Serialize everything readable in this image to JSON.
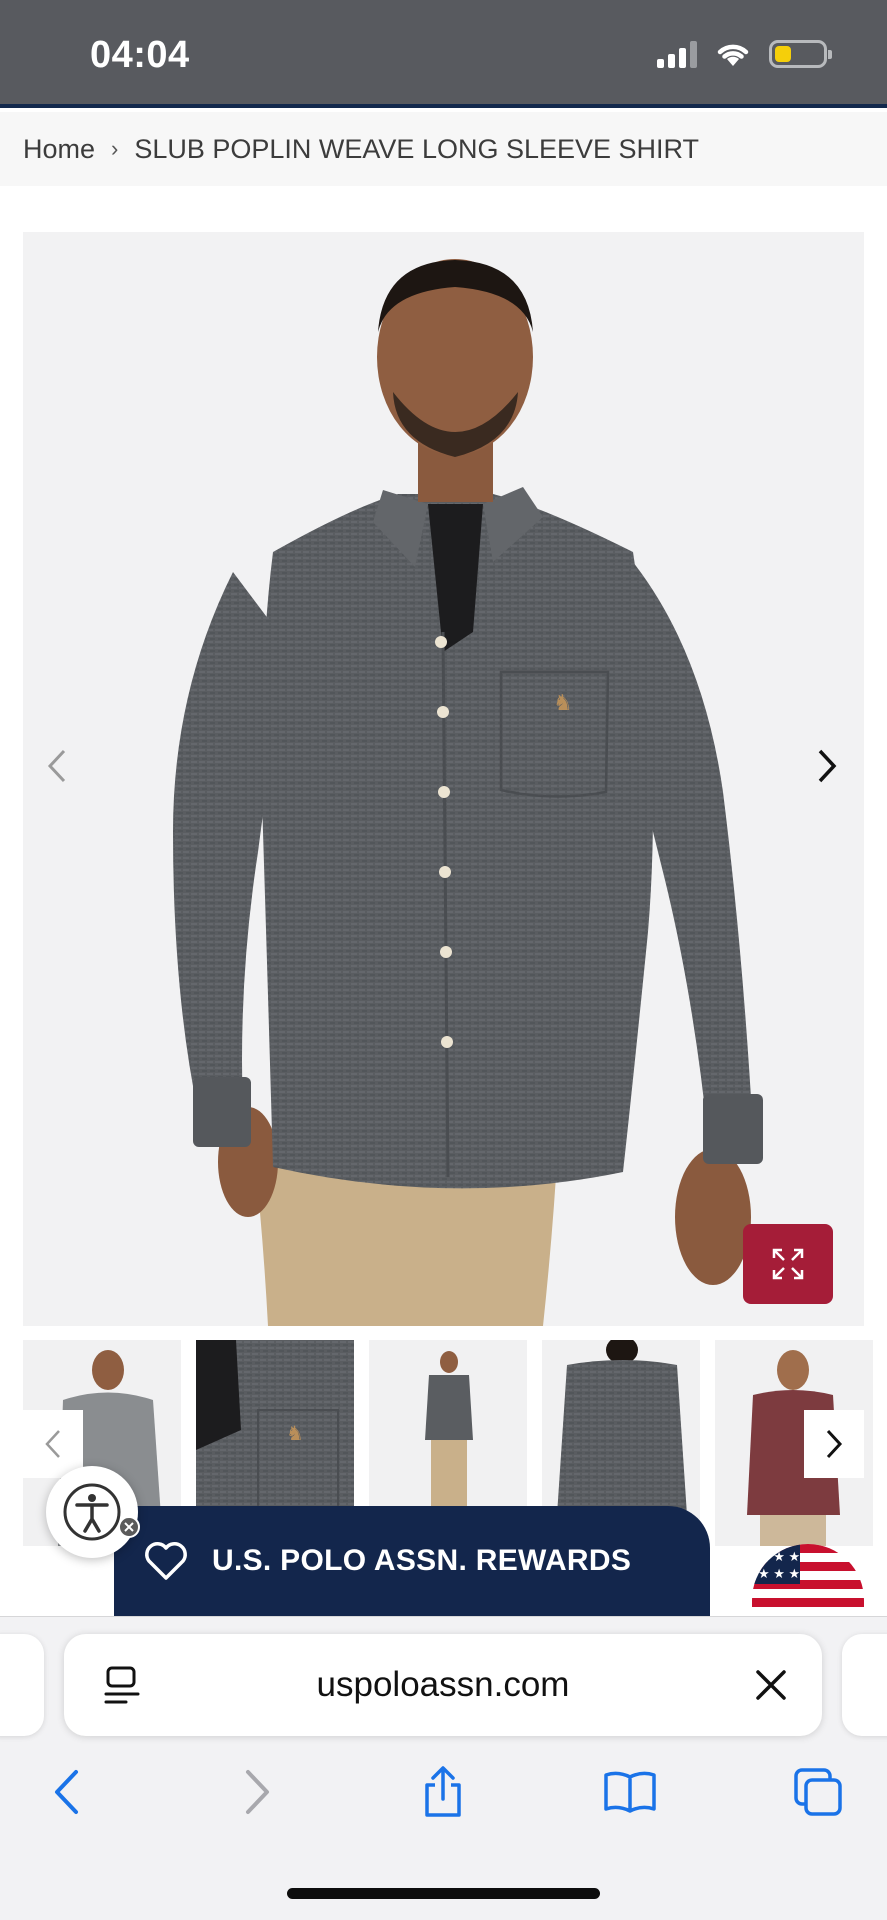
{
  "status_bar": {
    "time": "04:04",
    "icons": [
      "cellular-signal-icon",
      "wifi-icon",
      "battery-low-icon"
    ]
  },
  "breadcrumb": {
    "home": "Home",
    "separator": "›",
    "current": "SLUB POPLIN WEAVE LONG SLEEVE SHIRT"
  },
  "gallery": {
    "main_image_alt": "Model wearing charcoal slub poplin long sleeve shirt",
    "prev_icon": "chevron-left-icon",
    "next_icon": "chevron-right-icon",
    "expand_icon": "expand-icon",
    "thumbnails": [
      "Front view grey",
      "Detail pocket logo",
      "Full body front",
      "Back view",
      "Burgundy colorway"
    ]
  },
  "rewards": {
    "label": "U.S. POLO ASSN. REWARDS",
    "icon": "heart-icon"
  },
  "browser": {
    "url": "uspoloassn.com",
    "toolbar": [
      "back-icon",
      "forward-icon",
      "share-icon",
      "bookmarks-icon",
      "tabs-icon"
    ]
  },
  "colors": {
    "status_bar_bg": "#585a5f",
    "brand_navy": "#13264c",
    "accent_red": "#a51d38",
    "ios_blue": "#1a73e8"
  }
}
